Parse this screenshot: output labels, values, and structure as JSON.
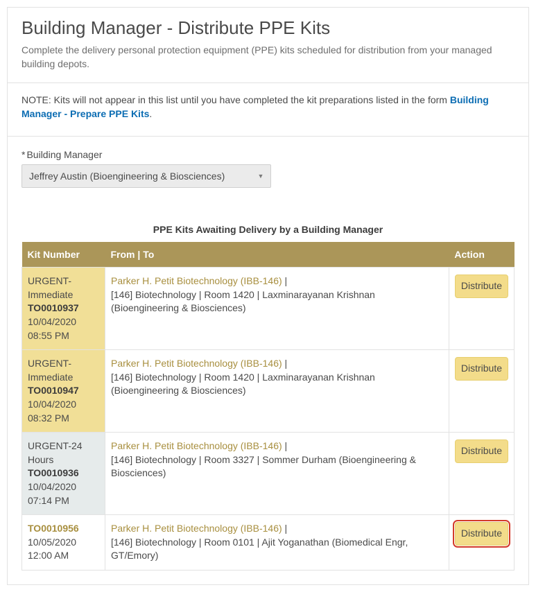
{
  "header": {
    "title": "Building Manager - Distribute PPE Kits",
    "subtitle": "Complete the delivery personal protection equipment (PPE) kits scheduled for distribution from your managed building depots."
  },
  "note": {
    "prefix": "NOTE: Kits will not appear in this list until you have completed the kit preparations listed in the form ",
    "link": "Building Manager - Prepare PPE Kits",
    "suffix": "."
  },
  "manager": {
    "label": "Building Manager",
    "value": "Jeffrey Austin (Bioengineering & Biosciences)"
  },
  "table": {
    "caption": "PPE Kits Awaiting Delivery by a Building Manager",
    "columns": {
      "kit": "Kit Number",
      "fromto": "From | To",
      "action": "Action"
    },
    "action_label": "Distribute",
    "rows": [
      {
        "kit_style": "yellow",
        "urgency": "URGENT-Immediate",
        "number": "TO0010937",
        "date": "10/04/2020 08:55 PM",
        "from": "Parker H. Petit Biotechnology (IBB-146)",
        "to": "[146] Biotechnology | Room 1420 | Laxminarayanan Krishnan (Bioengineering & Biosciences)",
        "highlight": false
      },
      {
        "kit_style": "yellow",
        "urgency": "URGENT-Immediate",
        "number": "TO0010947",
        "date": "10/04/2020 08:32 PM",
        "from": "Parker H. Petit Biotechnology (IBB-146)",
        "to": "[146] Biotechnology | Room 1420 | Laxminarayanan Krishnan (Bioengineering & Biosciences)",
        "highlight": false
      },
      {
        "kit_style": "grey",
        "urgency": "URGENT-24 Hours",
        "number": "TO0010936",
        "date": "10/04/2020 07:14 PM",
        "from": "Parker H. Petit Biotechnology (IBB-146)",
        "to": "[146] Biotechnology | Room 3327 | Sommer Durham (Bioengineering & Biosciences)",
        "highlight": false
      },
      {
        "kit_style": "white",
        "urgency": "",
        "number": "TO0010956",
        "date": "10/05/2020 12:00 AM",
        "from": "Parker H. Petit Biotechnology (IBB-146)",
        "to": "[146] Biotechnology | Room 0101 | Ajit Yoganathan (Biomedical Engr, GT/Emory)",
        "highlight": true
      }
    ]
  }
}
